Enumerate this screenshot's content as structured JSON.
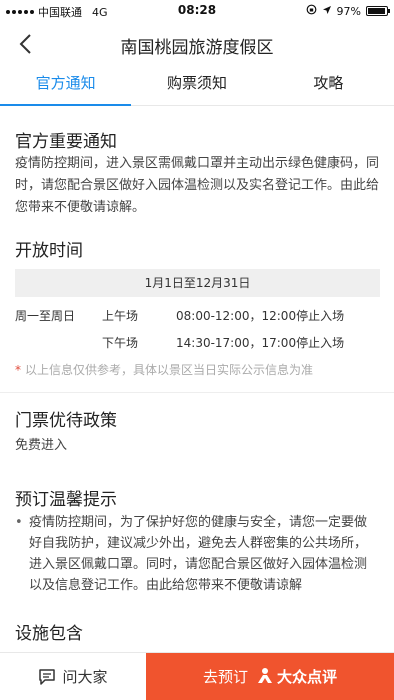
{
  "status_bar": {
    "carrier": "中国联通",
    "network": "4G",
    "time": "08:28",
    "battery": "97%",
    "battery_level": 0.97
  },
  "nav": {
    "title": "南国桃园旅游度假区"
  },
  "tabs": [
    "官方通知",
    "购票须知",
    "攻略"
  ],
  "notice": {
    "title": "官方重要通知",
    "text": "疫情防控期间，进入景区需佩戴口罩并主动出示绿色健康码，同时，请您配合景区做好入园体温检测以及实名登记工作。由此给您带来不便敬请谅解。"
  },
  "hours": {
    "title": "开放时间",
    "date_range": "1月1日至12月31日",
    "days": "周一至周日",
    "rows": [
      {
        "period": "上午场",
        "time": "08:00-12:00，12:00停止入场"
      },
      {
        "period": "下午场",
        "time": "14:30-17:00，17:00停止入场"
      }
    ],
    "note_star": "*",
    "note": "以上信息仅供参考，具体以景区当日实际公示信息为准"
  },
  "ticket_policy": {
    "title": "门票优待政策",
    "text": "免费进入"
  },
  "booking_tips": {
    "title": "预订温馨提示",
    "items": [
      "疫情防控期间，为了保护好您的健康与安全，请您一定要做好自我防护，建议减少外出，避免去人群密集的公共场所，进入景区佩戴口罩。同时，请您配合景区做好入园体温检测以及信息登记工作。由此给您带来不便敬请谅解"
    ]
  },
  "facilities": {
    "title": "设施包含"
  },
  "bottom_bar": {
    "ask_label": "问大家",
    "book_label": "去预订",
    "brand": "大众点评"
  },
  "colors": {
    "accent": "#1a8bea",
    "cta": "#f0542e",
    "star": "#e04a3a"
  },
  "icons": {
    "back": "chevron-left-icon",
    "ask": "chat-bubble-icon",
    "brand": "dianping-logo-icon"
  }
}
